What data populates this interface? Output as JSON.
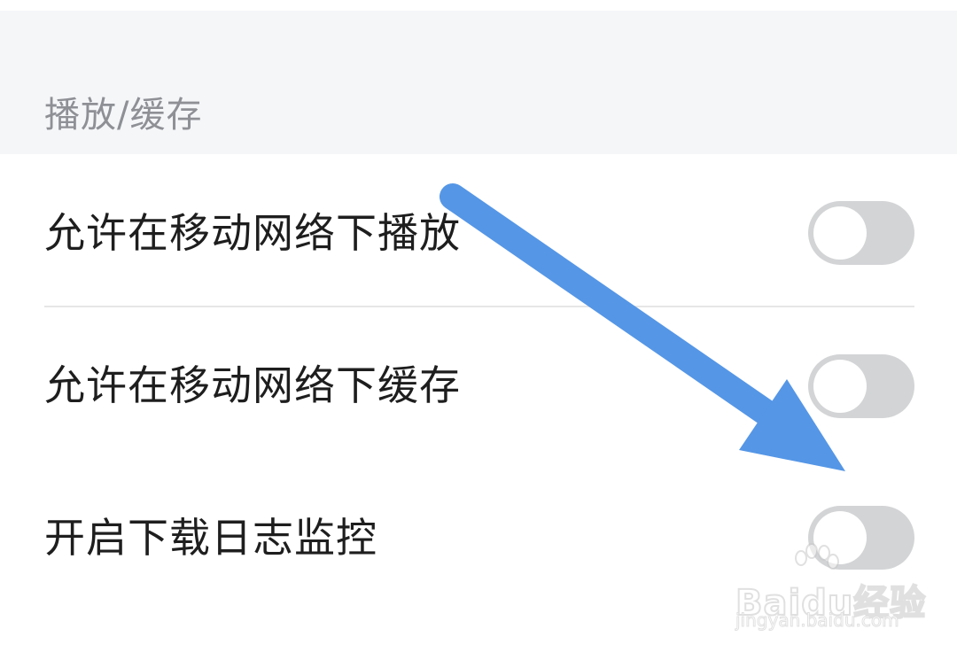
{
  "section": {
    "title": "播放/缓存"
  },
  "settings": [
    {
      "label": "允许在移动网络下播放",
      "enabled": false
    },
    {
      "label": "允许在移动网络下缓存",
      "enabled": false
    },
    {
      "label": "开启下载日志监控",
      "enabled": false
    }
  ],
  "annotation": {
    "arrow_color": "#5596e6"
  },
  "watermark": {
    "brand": "Baidu经验",
    "url": "jingyan.baidu.com"
  },
  "colors": {
    "header_background": "#f5f6f8",
    "toggle_off": "#d3d4d6",
    "text_primary": "#1e1e1e",
    "text_secondary": "#8e9096"
  }
}
